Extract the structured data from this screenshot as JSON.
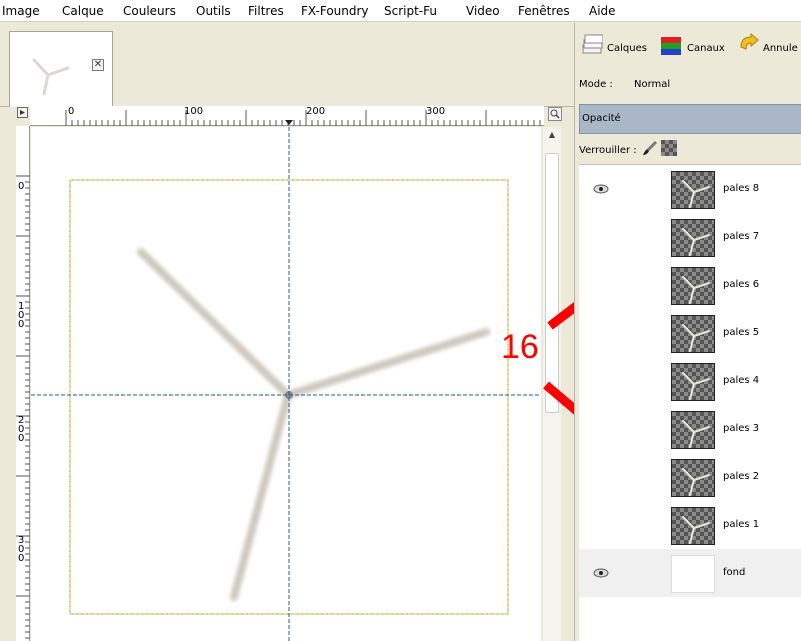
{
  "menu": {
    "items": [
      "Image",
      "Calque",
      "Couleurs",
      "Outils",
      "Filtres",
      "FX-Foundry",
      "Script-Fu",
      "Video",
      "Fenêtres",
      "Aide"
    ]
  },
  "image_tab": {
    "close_icon": "close-icon",
    "close_glyph": "✕"
  },
  "rulers": {
    "horizontal_labels": [
      "0",
      "100",
      "200",
      "300"
    ],
    "vertical_labels": [
      "0",
      "100",
      "200",
      "300"
    ]
  },
  "annotation": {
    "number": "16",
    "color": "#ff0000"
  },
  "dock": {
    "tabs": [
      "Calques",
      "Canaux",
      "Annule"
    ],
    "mode_label": "Mode :",
    "mode_value": "Normal",
    "opacity_label": "Opacité",
    "lock_label": "Verrouiller :"
  },
  "layers": [
    {
      "name": "pales 8",
      "visible": true
    },
    {
      "name": "pales 7",
      "visible": false
    },
    {
      "name": "pales 6",
      "visible": false
    },
    {
      "name": "pales 5",
      "visible": false
    },
    {
      "name": "pales 4",
      "visible": false
    },
    {
      "name": "pales 3",
      "visible": false
    },
    {
      "name": "pales 2",
      "visible": false
    },
    {
      "name": "pales 1",
      "visible": false
    },
    {
      "name": "fond",
      "visible": true
    }
  ],
  "colors": {
    "guide": "#1a5fa0",
    "selection_dash": "#e0d000",
    "blade": "#d8d4cc",
    "opacity_bar": "#a9b7c6",
    "checker_dark": "#555555",
    "checker_light": "#8a8a8a"
  }
}
